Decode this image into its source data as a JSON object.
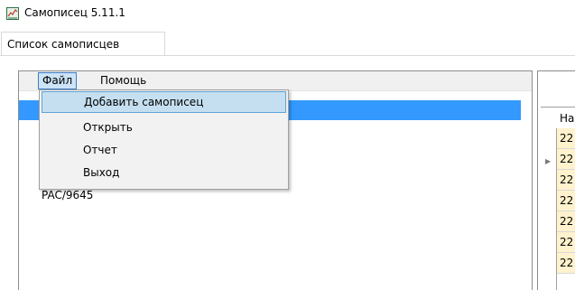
{
  "window": {
    "title": "Самописец 5.11.1",
    "icon": "app-chart-icon"
  },
  "tabs": [
    {
      "label": "Список самописцев",
      "active": true
    }
  ],
  "menubar": {
    "file": "Файл",
    "help": "Помощь"
  },
  "file_menu": {
    "items": [
      {
        "label": "Добавить самописец",
        "highlighted": true
      },
      {
        "label": "Открыть"
      },
      {
        "label": "Отчет"
      },
      {
        "label": "Выход"
      }
    ]
  },
  "recorder_list": {
    "partially_visible_item": "PAC/9645"
  },
  "grid": {
    "header": "На",
    "rows": [
      "22",
      "22",
      "22",
      "22",
      "22",
      "22",
      "22"
    ]
  },
  "colors": {
    "selection": "#3399ff",
    "menu_highlight": "#c5dff0",
    "row_fill": "#fff2cc"
  }
}
